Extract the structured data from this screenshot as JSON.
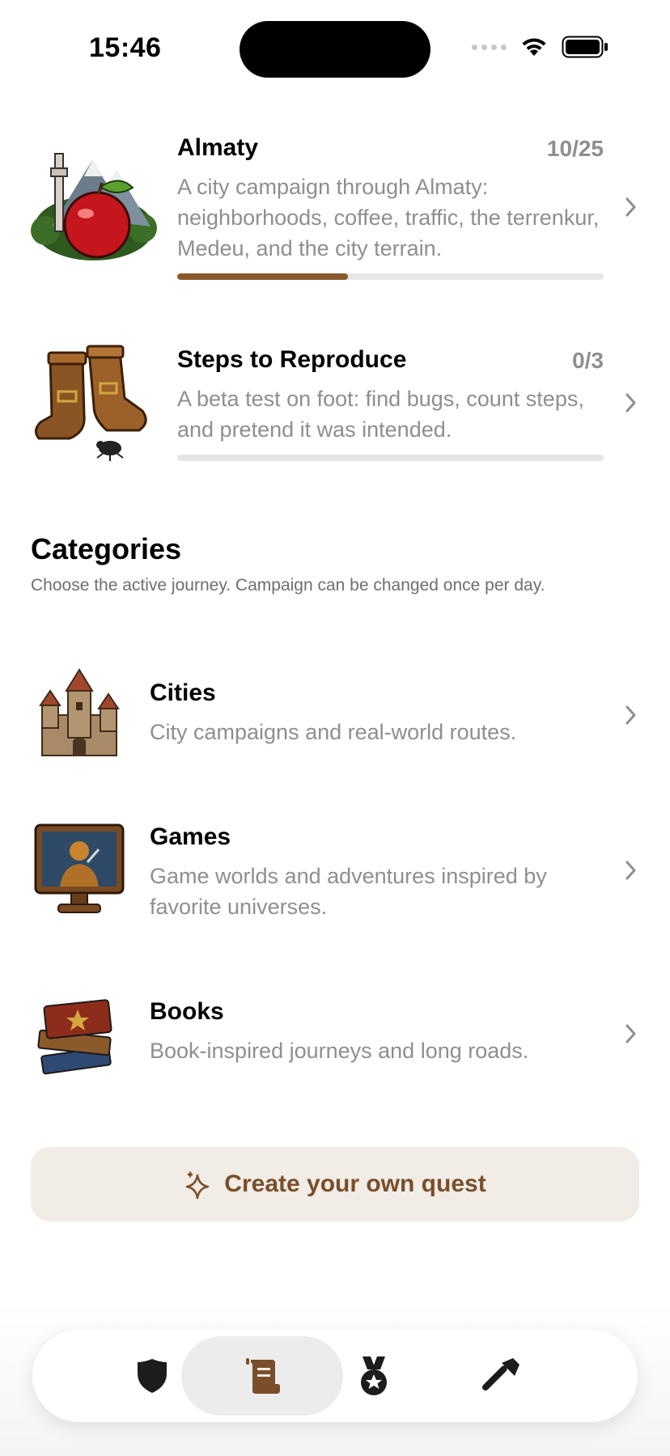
{
  "status": {
    "time": "15:46"
  },
  "quests": [
    {
      "title": "Almaty",
      "count": "10/25",
      "description": "A city campaign through Almaty: neighborhoods, coffee, traffic, the terrenkur, Medeu, and the city terrain.",
      "progress": 0.4,
      "icon": "apple-mountain-icon"
    },
    {
      "title": "Steps to Reproduce",
      "count": "0/3",
      "description": "A beta test on foot: find bugs, count steps, and pretend it was intended.",
      "progress": 0,
      "icon": "boots-bug-icon"
    }
  ],
  "categories_section": {
    "title": "Categories",
    "subtitle": "Choose the active journey. Campaign can be changed once per day."
  },
  "categories": [
    {
      "title": "Cities",
      "description": "City campaigns and real-world routes.",
      "icon": "castle-icon"
    },
    {
      "title": "Games",
      "description": "Game worlds and adventures inspired by favorite universes.",
      "icon": "monitor-hero-icon"
    },
    {
      "title": "Books",
      "description": "Book-inspired journeys and long roads.",
      "icon": "books-icon"
    }
  ],
  "create_button": {
    "label": "Create your own quest",
    "icon": "sparkle-icon"
  },
  "tabs": [
    {
      "icon": "shield-icon",
      "active": false
    },
    {
      "icon": "scroll-icon",
      "active": true
    },
    {
      "icon": "medal-icon",
      "active": false
    },
    {
      "icon": "hammer-icon",
      "active": false
    }
  ],
  "colors": {
    "accent": "#8b5a2b",
    "accent_text": "#7a4e2a",
    "button_bg": "#f1ece6",
    "secondary_text": "#8e8e93"
  }
}
